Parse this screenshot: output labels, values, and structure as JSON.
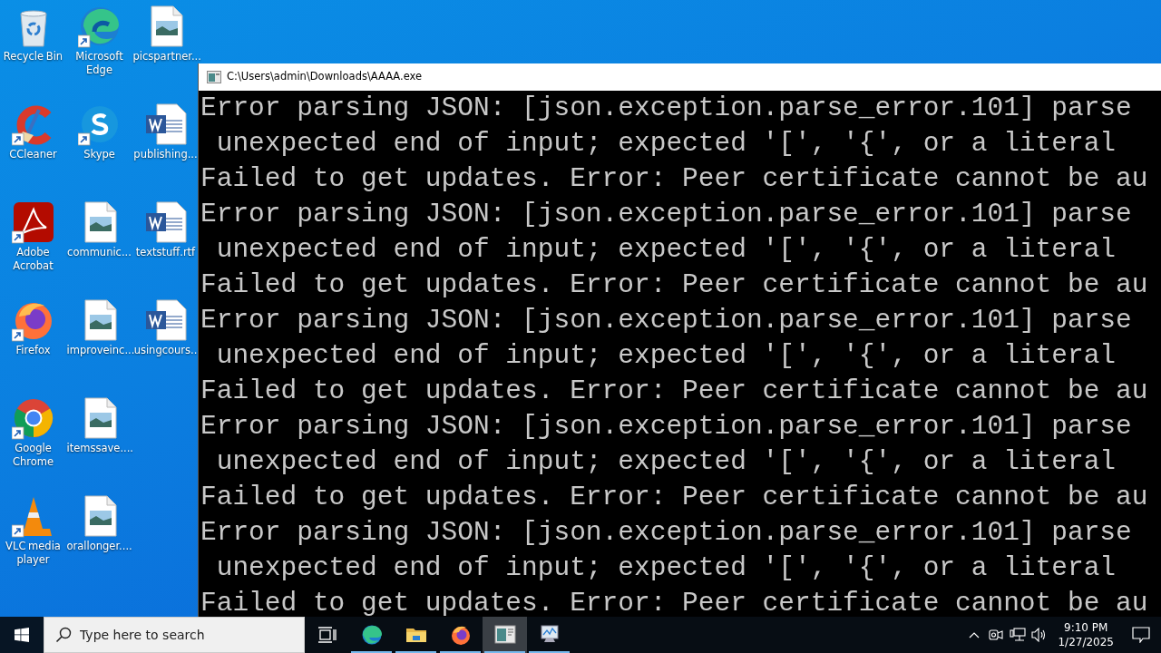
{
  "desktop_icons": [
    {
      "label": "Recycle Bin",
      "kind": "recycle",
      "shortcut": false
    },
    {
      "label": "CCleaner",
      "kind": "ccleaner",
      "shortcut": true
    },
    {
      "label": "Adobe Acrobat",
      "kind": "acrobat",
      "shortcut": true
    },
    {
      "label": "Firefox",
      "kind": "firefox",
      "shortcut": true
    },
    {
      "label": "Google Chrome",
      "kind": "chrome",
      "shortcut": true
    },
    {
      "label": "VLC media player",
      "kind": "vlc",
      "shortcut": true
    },
    {
      "label": "Microsoft Edge",
      "kind": "edge",
      "shortcut": true
    },
    {
      "label": "Skype",
      "kind": "skype",
      "shortcut": true
    },
    {
      "label": "communic...",
      "kind": "image",
      "shortcut": false
    },
    {
      "label": "improveinc...",
      "kind": "image",
      "shortcut": false
    },
    {
      "label": "itemssave....",
      "kind": "image",
      "shortcut": false
    },
    {
      "label": "orallonger....",
      "kind": "image",
      "shortcut": false
    },
    {
      "label": "picspartner...",
      "kind": "image",
      "shortcut": false
    },
    {
      "label": "publishing...",
      "kind": "word",
      "shortcut": false
    },
    {
      "label": "textstuff.rtf",
      "kind": "word",
      "shortcut": false
    },
    {
      "label": "usingcours..",
      "kind": "word",
      "shortcut": false
    }
  ],
  "console": {
    "title": "C:\\Users\\admin\\Downloads\\AAAA.exe",
    "lines": [
      "Error parsing JSON: [json.exception.parse_error.101] parse",
      " unexpected end of input; expected '[', '{', or a literal",
      "Failed to get updates. Error: Peer certificate cannot be au",
      "Error parsing JSON: [json.exception.parse_error.101] parse",
      " unexpected end of input; expected '[', '{', or a literal",
      "Failed to get updates. Error: Peer certificate cannot be au",
      "Error parsing JSON: [json.exception.parse_error.101] parse",
      " unexpected end of input; expected '[', '{', or a literal",
      "Failed to get updates. Error: Peer certificate cannot be au",
      "Error parsing JSON: [json.exception.parse_error.101] parse",
      " unexpected end of input; expected '[', '{', or a literal",
      "Failed to get updates. Error: Peer certificate cannot be au",
      "Error parsing JSON: [json.exception.parse_error.101] parse",
      " unexpected end of input; expected '[', '{', or a literal",
      "Failed to get updates. Error: Peer certificate cannot be au"
    ]
  },
  "taskbar": {
    "search": {
      "placeholder": "Type here to search"
    },
    "apps": [
      {
        "kind": "edge",
        "running": true,
        "selected": false
      },
      {
        "kind": "explorer",
        "running": true,
        "selected": false
      },
      {
        "kind": "firefox",
        "running": true,
        "selected": false
      },
      {
        "kind": "console",
        "running": true,
        "selected": true
      },
      {
        "kind": "monitor",
        "running": true,
        "selected": false
      }
    ],
    "time": "9:10 PM",
    "date": "1/27/2025"
  }
}
